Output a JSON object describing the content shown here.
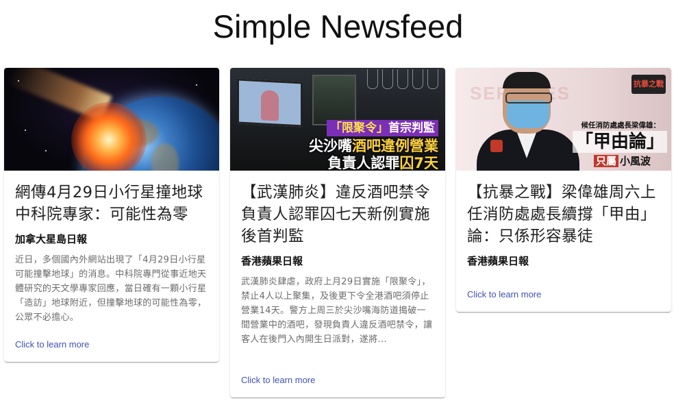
{
  "page": {
    "title": "Simple Newsfeed"
  },
  "cards": [
    {
      "headline": "網傳4月29日小行星撞地球中科院專家：可能性為零",
      "source": "加拿大星島日報",
      "summary": "近日，多個國內外網站出現了「4月29日小行星可能撞擊地球」的消息。中科院專門從事近地天體研究的天文學專家回應，當日確有一顆小行星「造訪」地球附近，但撞擊地球的可能性為零，公眾不必擔心。",
      "link_label": "Click to learn more",
      "image": {
        "subject": "earth-asteroid-impact"
      }
    },
    {
      "headline": "【武漢肺炎】違反酒吧禁令負責人認罪囚七天新例實施後首判監",
      "source": "香港蘋果日報",
      "summary": "武漢肺炎肆虐，政府上月29日實施「限聚令」，禁止4人以上聚集，及後更下令全港酒吧須停止營業14天。警方上周三於尖沙嘴海防道搗破一間營業中的酒吧，發現負責人違反酒吧禁令，讓客人在後門入內開生日派對，遂將...",
      "link_label": "Click to learn more",
      "image": {
        "subject": "bar-news-screen",
        "tag_part1": "「限聚令」",
        "tag_part2": "首宗判監",
        "line2_part1": "尖沙嘴",
        "line2_part2": "酒吧違例營業",
        "line3_part1": "負責人認罪",
        "line3_part2": "囚7天"
      }
    },
    {
      "headline": "【抗暴之戰】梁偉雄周六上任消防處處長續撐「甲由」論：只係形容暴徒",
      "source": "香港蘋果日報",
      "summary": "",
      "link_label": "Click to learn more",
      "image": {
        "subject": "fire-services-officer",
        "bg_text": "SERVICES",
        "caption1": "候任消防處處長梁偉雄：",
        "caption2": "「甲由論」",
        "caption3_part1": "只屬",
        "caption3_part2": "小風波",
        "logo": "抗暴之戰"
      }
    }
  ]
}
